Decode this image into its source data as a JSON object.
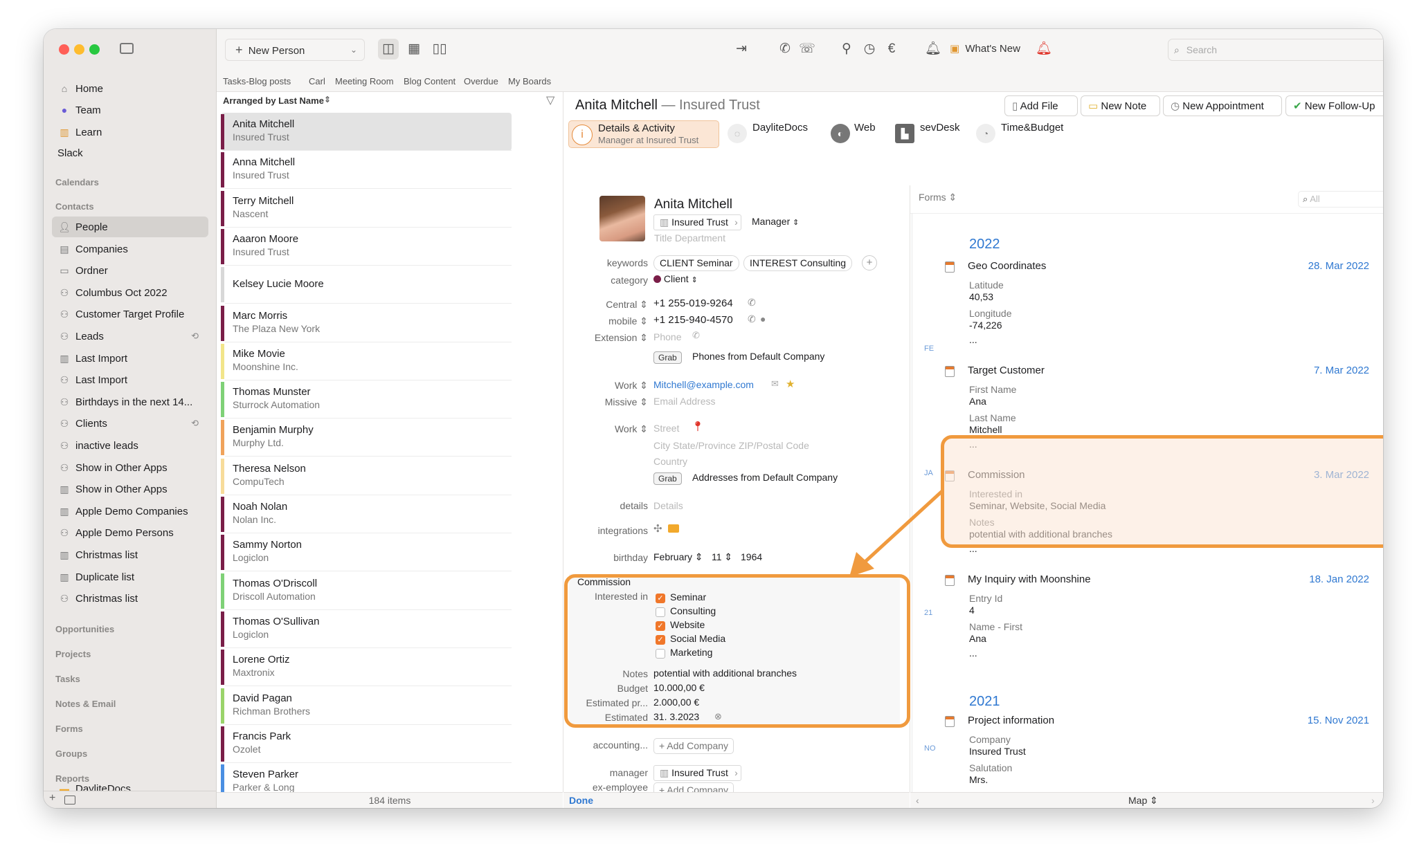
{
  "toolbar": {
    "new_person": "New Person",
    "whats_new": "What's New",
    "search_placeholder": "Search"
  },
  "boards": [
    "Tasks-Blog posts",
    "Carl",
    "Meeting Room",
    "Blog Content",
    "Overdue",
    "My Boards"
  ],
  "sidebar": {
    "top": [
      "Home",
      "Team",
      "Learn",
      "Slack"
    ],
    "calendars": "Calendars",
    "contacts": "Contacts",
    "contact_items": [
      "People",
      "Companies",
      "Ordner",
      "Columbus Oct 2022",
      "Customer Target Profile",
      "Leads",
      "Last Import",
      "Last Import",
      "Birthdays in the next 14...",
      "Clients",
      "inactive leads",
      "Show in Other Apps",
      "Show in Other Apps",
      "Apple Demo Companies",
      "Apple Demo Persons",
      "Christmas list",
      "Duplicate list",
      "Christmas list"
    ],
    "sections": [
      "Opportunities",
      "Projects",
      "Tasks",
      "Notes & Email",
      "Forms",
      "Groups",
      "Reports"
    ],
    "reports_item": "DayliteDocs"
  },
  "list": {
    "arranged_by": "Arranged by Last Name",
    "count": "184 items",
    "rows": [
      {
        "name": "Anita Mitchell",
        "sub": "Insured Trust",
        "color": "#7a1e48"
      },
      {
        "name": "Anna Mitchell",
        "sub": "Insured Trust",
        "color": "#7a1e48"
      },
      {
        "name": "Terry Mitchell",
        "sub": "Nascent",
        "color": "#7a1e48"
      },
      {
        "name": "Aaaron Moore",
        "sub": "Insured Trust",
        "color": "#7a1e48"
      },
      {
        "name": "Kelsey Lucie Moore",
        "sub": "",
        "color": "#d8d8d8"
      },
      {
        "name": "Marc Morris",
        "sub": "The Plaza New York",
        "color": "#7a1e48"
      },
      {
        "name": "Mike Movie",
        "sub": "Moonshine Inc.",
        "color": "#f2e58a"
      },
      {
        "name": "Thomas Munster",
        "sub": "Sturrock Automation",
        "color": "#7fd177"
      },
      {
        "name": "Benjamin Murphy",
        "sub": "Murphy Ltd.",
        "color": "#f0a35b"
      },
      {
        "name": "Theresa Nelson",
        "sub": "CompuTech",
        "color": "#f7dc9a"
      },
      {
        "name": "Noah Nolan",
        "sub": "Nolan Inc.",
        "color": "#7a1e48"
      },
      {
        "name": "Sammy Norton",
        "sub": "Logiclon",
        "color": "#7a1e48"
      },
      {
        "name": "Thomas O'Driscoll",
        "sub": "Driscoll Automation",
        "color": "#7fd177"
      },
      {
        "name": "Thomas O'Sullivan",
        "sub": "Logiclon",
        "color": "#7a1e48"
      },
      {
        "name": "Lorene Ortiz",
        "sub": "Maxtronix",
        "color": "#7a1e48"
      },
      {
        "name": "David Pagan",
        "sub": "Richman Brothers",
        "color": "#9ad46a"
      },
      {
        "name": "Francis Park",
        "sub": "Ozolet",
        "color": "#7a1e48"
      },
      {
        "name": "Steven Parker",
        "sub": "Parker & Long",
        "color": "#4a8fe2"
      }
    ]
  },
  "detail": {
    "name": "Anita Mitchell",
    "company_suffix": "— Insured Trust",
    "buttons": [
      "Add File",
      "New Note",
      "New Appointment",
      "New Follow-Up"
    ],
    "tabs": [
      {
        "label": "Details & Activity",
        "sub": "Manager at Insured Trust"
      },
      {
        "label": "DayliteDocs",
        "sub": ""
      },
      {
        "label": "Web",
        "sub": ""
      },
      {
        "label": "sevDesk",
        "sub": ""
      },
      {
        "label": "Time&Budget",
        "sub": ""
      }
    ]
  },
  "person": {
    "name": "Anita Mitchell",
    "company": "Insured Trust",
    "role": "Manager",
    "title_ph": "Title Department",
    "keywords_label": "keywords",
    "keywords": [
      "CLIENT Seminar",
      "INTEREST Consulting"
    ],
    "category_label": "category",
    "category": "Client",
    "phones": [
      {
        "label": "Central",
        "value": "+1 255-019-9264"
      },
      {
        "label": "mobile",
        "value": "+1 215-940-4570"
      },
      {
        "label": "Extension",
        "value": "Phone"
      }
    ],
    "grab_label": "Grab",
    "phones_default": "Phones from Default Company",
    "email_label": "Work",
    "email": "Mitchell@example.com",
    "missive_label": "Missive",
    "missive_ph": "Email Address",
    "address_label": "Work",
    "street_ph": "Street",
    "city_ph": "City State/Province ZIP/Postal Code",
    "country_ph": "Country",
    "addresses_default": "Addresses from Default Company",
    "details_label": "details",
    "details_ph": "Details",
    "integrations_label": "integrations",
    "birthday_label": "birthday",
    "birthday_month": "February",
    "birthday_day": "11",
    "birthday_year": "1964"
  },
  "commission": {
    "title": "Commission",
    "interested_label": "Interested in",
    "options": [
      {
        "label": "Seminar",
        "checked": true
      },
      {
        "label": "Consulting",
        "checked": false
      },
      {
        "label": "Website",
        "checked": true
      },
      {
        "label": "Social Media",
        "checked": true
      },
      {
        "label": "Marketing",
        "checked": false
      }
    ],
    "notes_label": "Notes",
    "notes": "potential with additional branches",
    "budget_label": "Budget",
    "budget": "10.000,00 €",
    "estpr_label": "Estimated pr...",
    "estpr": "2.000,00 €",
    "est_label": "Estimated",
    "est": "31.  3.2023"
  },
  "relations": {
    "accounting_label": "accounting...",
    "add_company": "+ Add Company",
    "manager_label": "manager",
    "manager_company": "Insured Trust",
    "exemployee_label": "ex-employee"
  },
  "form_footer": "Done",
  "timeline": {
    "header": "Forms",
    "filter_ph": "All",
    "years": [
      "2022",
      "2021"
    ],
    "months": [
      "FE",
      "JA",
      "21",
      "NO"
    ],
    "entries": [
      {
        "title": "Geo Coordinates",
        "date": "28. Mar 2022",
        "fields": [
          [
            "Latitude",
            "40,53"
          ],
          [
            "Longitude",
            "-74,226"
          ]
        ]
      },
      {
        "title": "Target Customer",
        "date": "7. Mar 2022",
        "fields": [
          [
            "First Name",
            "Ana"
          ],
          [
            "Last Name",
            "Mitchell"
          ]
        ]
      },
      {
        "title": "Commission",
        "date": "3. Mar 2022",
        "fields": [
          [
            "Interested in",
            "Seminar, Website, Social Media"
          ],
          [
            "Notes",
            "potential with additional branches"
          ]
        ]
      },
      {
        "title": "My Inquiry with Moonshine",
        "date": "18. Jan 2022",
        "fields": [
          [
            "Entry Id",
            "4"
          ],
          [
            "Name - First",
            "Ana"
          ]
        ]
      },
      {
        "title": "Project information",
        "date": "15. Nov 2021",
        "fields": [
          [
            "Company",
            "Insured Trust"
          ],
          [
            "Salutation",
            "Mrs."
          ]
        ]
      }
    ],
    "ellipsis": "...",
    "footer": "Map"
  }
}
